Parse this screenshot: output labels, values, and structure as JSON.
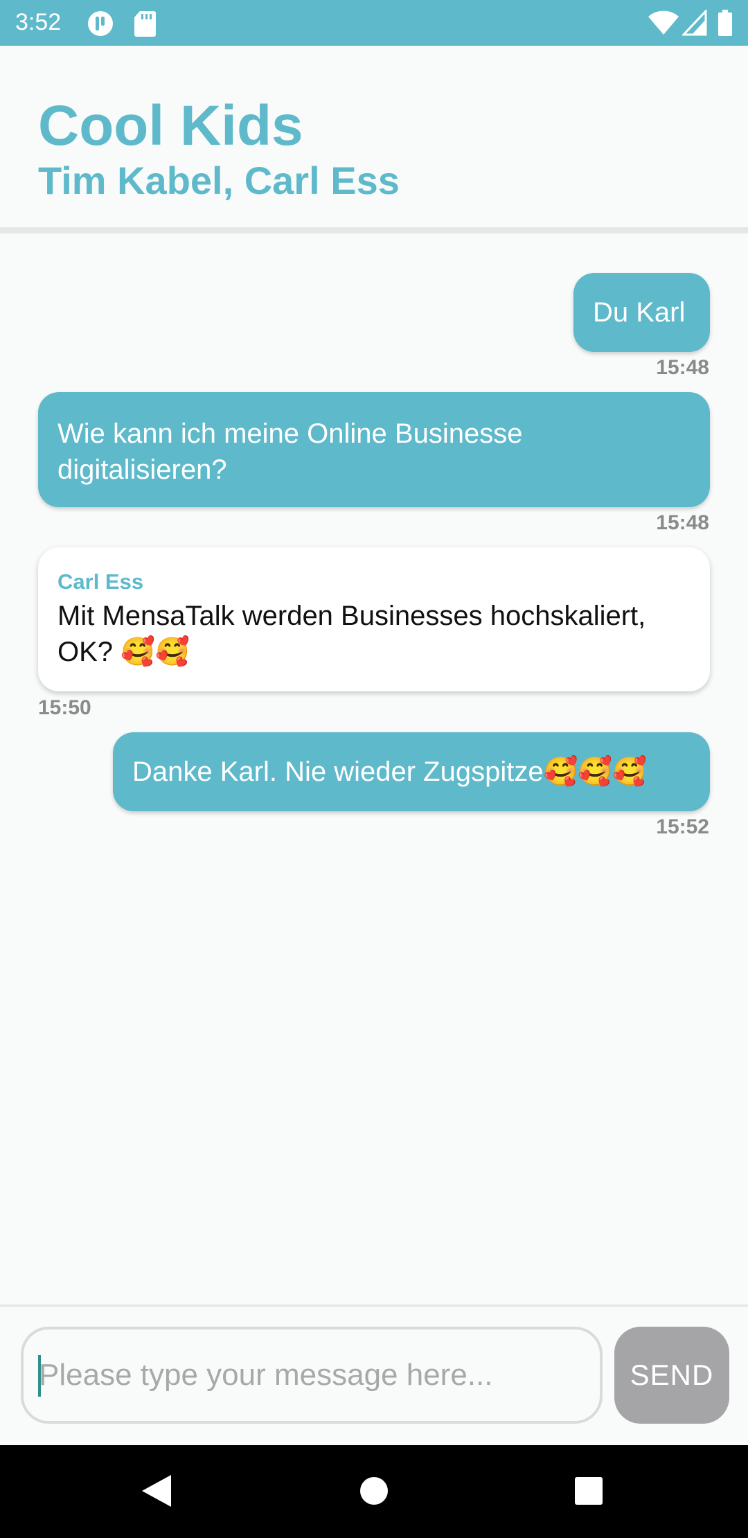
{
  "status_bar": {
    "time": "3:52",
    "left_icons": [
      "app-notification-icon",
      "sd-card-icon"
    ],
    "right_icons": [
      "wifi-icon",
      "cell-signal-icon",
      "battery-icon"
    ]
  },
  "header": {
    "title": "Cool Kids",
    "members": "Tim Kabel, Carl Ess"
  },
  "messages": [
    {
      "direction": "out",
      "text": "Du Karl",
      "time": "15:48"
    },
    {
      "direction": "out",
      "text": "Wie kann ich meine Online Businesse digitalisieren?",
      "time": "15:48"
    },
    {
      "direction": "in",
      "sender": "Carl Ess",
      "text": "Mit MensaTalk werden Businesses hochskaliert, OK? 🥰🥰",
      "time": "15:50"
    },
    {
      "direction": "out",
      "text": "Danke Karl. Nie wieder Zugspitze🥰🥰🥰",
      "time": "15:52"
    }
  ],
  "composer": {
    "placeholder": "Please type your message here...",
    "value": "",
    "send_label": "SEND"
  },
  "nav_bar": {
    "icons": [
      "back-icon",
      "home-icon",
      "recents-icon"
    ]
  },
  "colors": {
    "accent": "#5eb9cb",
    "incoming_bubble": "#ffffff",
    "send_disabled": "#a5a5a7",
    "timestamp": "#8a8a8a"
  }
}
